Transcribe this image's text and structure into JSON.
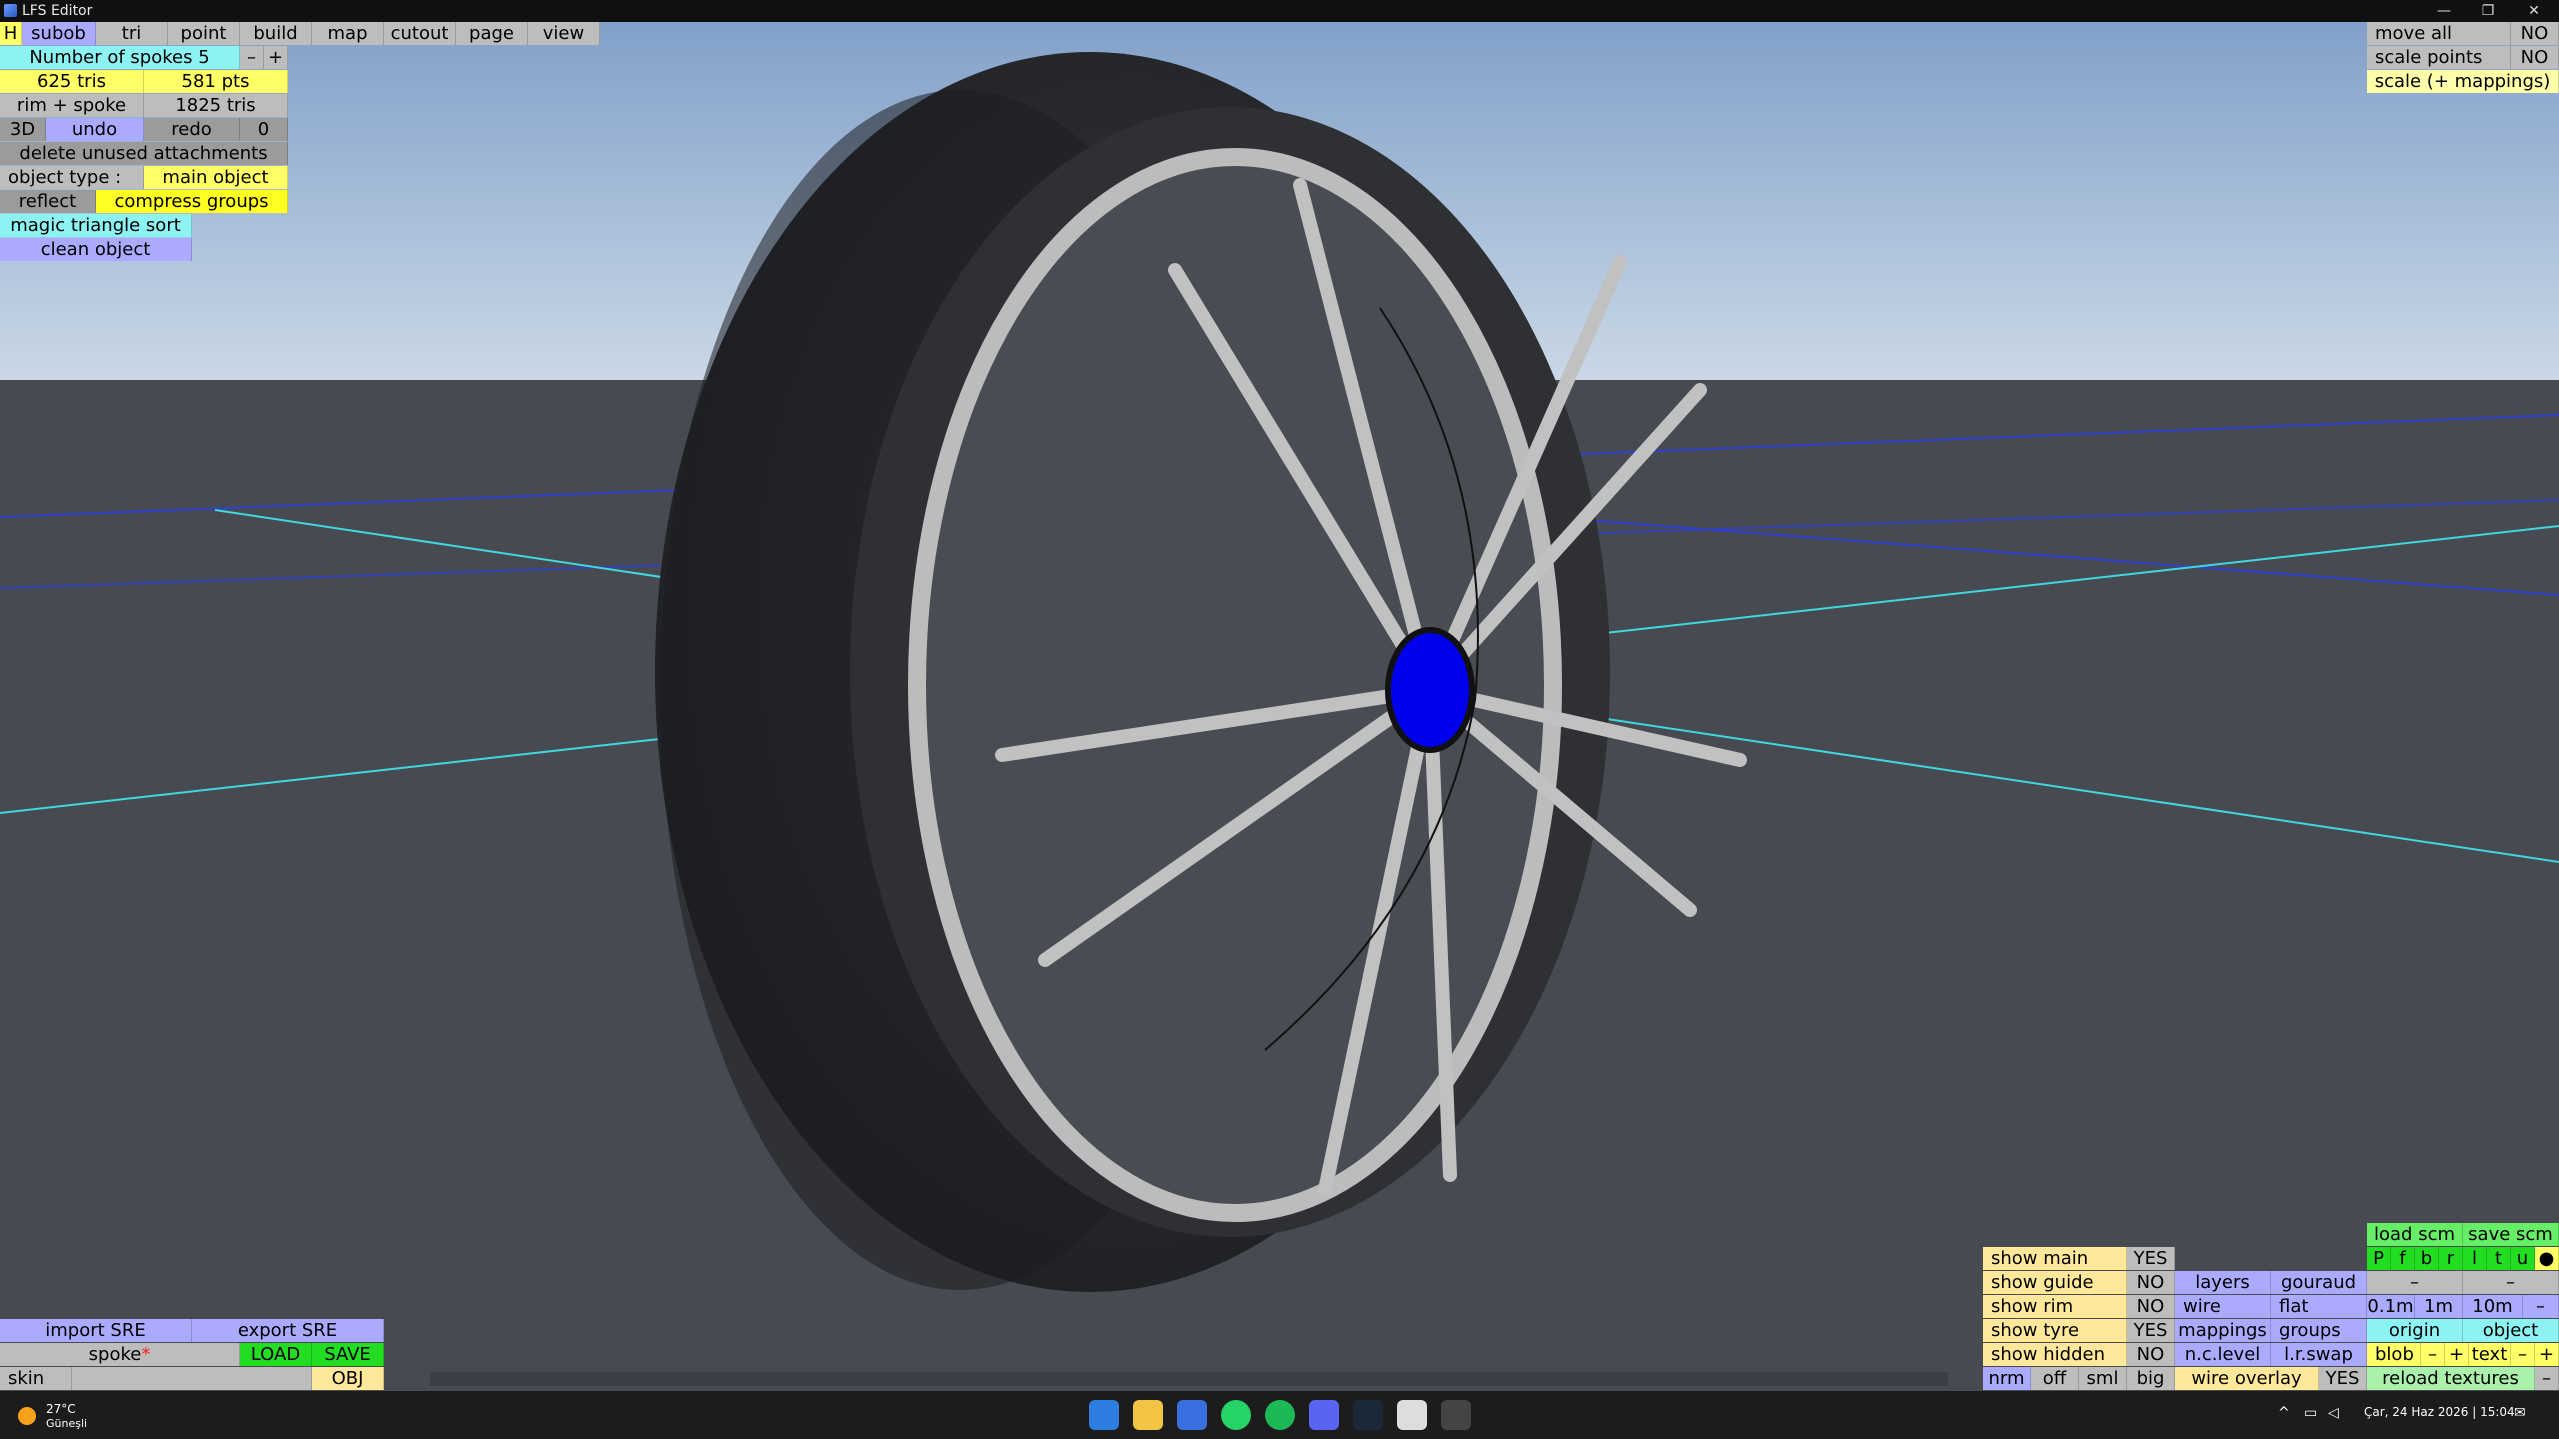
{
  "window": {
    "title": "LFS Editor"
  },
  "menu": {
    "h": "H",
    "subob": "subob",
    "tri": "tri",
    "point": "point",
    "build": "build",
    "map": "map",
    "cutout": "cutout",
    "page": "page",
    "view": "view"
  },
  "left_panel": {
    "spokes_label": "Number of spokes 5",
    "minus": "–",
    "plus": "+",
    "tris": "625 tris",
    "pts": "581 pts",
    "rim_spoke": "rim + spoke",
    "total_tris": "1825 tris",
    "mode_3d": "3D",
    "undo": "undo",
    "redo": "redo",
    "redo_count": "0",
    "delete_unused": "delete unused attachments",
    "object_type_label": "object type :",
    "object_type_value": "main object",
    "reflect": "reflect",
    "compress_groups": "compress groups",
    "magic_sort": "magic triangle sort",
    "clean_object": "clean object"
  },
  "top_right": {
    "move_all": "move all",
    "move_all_val": "NO",
    "scale_points": "scale points",
    "scale_points_val": "NO",
    "scale_mappings": "scale (+ mappings)"
  },
  "bottom_left": {
    "import_sre": "import SRE",
    "export_sre": "export SRE",
    "spoke": "spoke",
    "spoke_mark": "*",
    "load": "LOAD",
    "save": "SAVE",
    "skin": "skin",
    "obj": "OBJ"
  },
  "bottom_right": {
    "load_scm": "load scm",
    "save_scm": "save scm",
    "views": [
      "P",
      "f",
      "b",
      "r",
      "l",
      "t",
      "u",
      "●"
    ],
    "dash": "–",
    "show_main": "show main",
    "show_main_val": "YES",
    "show_guide": "show guide",
    "show_guide_val": "NO",
    "show_rim": "show rim",
    "show_rim_val": "NO",
    "show_tyre": "show tyre",
    "show_tyre_val": "YES",
    "show_hidden": "show hidden",
    "show_hidden_val": "NO",
    "layers": "layers",
    "gouraud": "gouraud",
    "wire": "wire",
    "flat": "flat",
    "grid_01": "0.1m",
    "grid_1": "1m",
    "grid_10": "10m",
    "mappings": "mappings",
    "groups": "groups",
    "origin": "origin",
    "object": "object",
    "nclevel": "n.c.level",
    "lrswap": "l.r.swap",
    "blob": "blob",
    "text": "text",
    "minus": "–",
    "plus": "+",
    "nrm": "nrm",
    "off": "off",
    "sml": "sml",
    "big": "big",
    "wire_overlay": "wire overlay",
    "wire_overlay_val": "YES",
    "reload_textures": "reload textures"
  },
  "taskbar": {
    "temperature": "27°C",
    "weather": "Güneşli",
    "datetime": "Çar, 24 Haz 2026 | 15:04"
  },
  "colors": {
    "sky_top": "#7d9dc8",
    "sky_bottom": "#cad8e6",
    "ground": "#484a52",
    "hub": "#0000ee",
    "spoke": "#c1c1c1",
    "tyre": "#2b2d30"
  }
}
